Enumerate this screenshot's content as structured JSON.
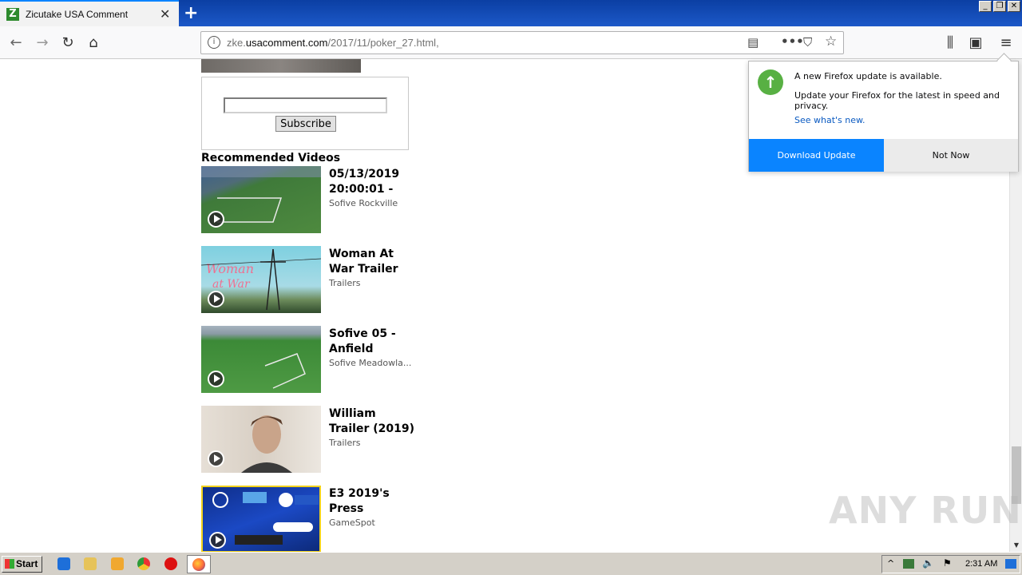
{
  "browser": {
    "tab_title": "Zicutake USA Comment",
    "tab_favicon_letter": "Z",
    "url_prefix": "zke.",
    "url_domain": "usacomment.com",
    "url_path": "/2017/11/poker_27.html,"
  },
  "page": {
    "subscribe_label": "Subscribe",
    "recommended_title": "Recommended Videos",
    "videos": [
      {
        "title": "05/13/2019 20:00:01 -",
        "channel": "Sofive Rockville",
        "thumb": "soccer-field-icon"
      },
      {
        "title": "Woman At War Trailer",
        "channel": "Trailers",
        "thumb": "power-line-icon"
      },
      {
        "title": "Sofive 05 - Anfield",
        "channel": "Sofive Meadowla...",
        "thumb": "soccer-field-icon"
      },
      {
        "title": "William Trailer (2019)",
        "channel": "Trailers",
        "thumb": "portrait-icon"
      },
      {
        "title": "E3 2019's Press",
        "channel": "GameSpot",
        "thumb": "e3-logos-icon"
      }
    ]
  },
  "watermark": "ANY RUN",
  "doorhanger": {
    "title": "A new Firefox update is available.",
    "body": "Update your Firefox for the latest in speed and privacy.",
    "link": "See what's new.",
    "primary": "Download Update",
    "secondary": "Not Now"
  },
  "taskbar": {
    "start_label": "Start",
    "clock": "2:31 AM"
  },
  "colors": {
    "accent": "#0a84ff",
    "update_green": "#58b043",
    "titlebar": "#1c58c8"
  }
}
